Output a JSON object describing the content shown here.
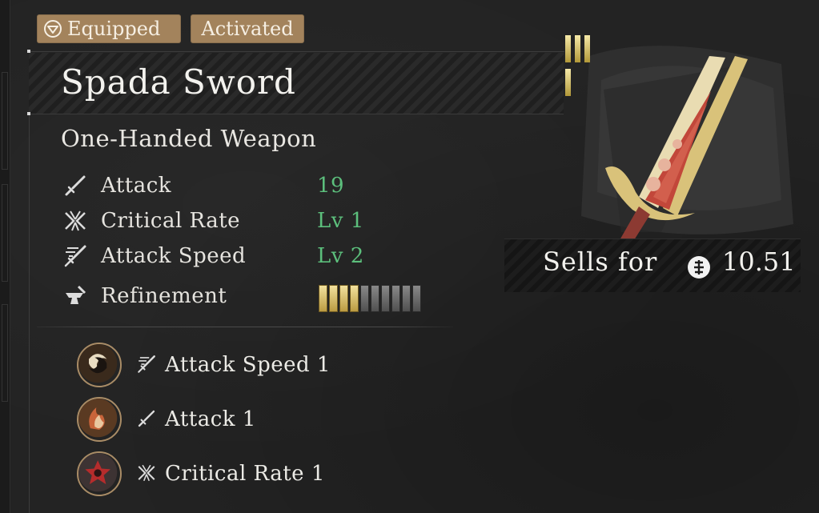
{
  "badges": {
    "equipped": "Equipped",
    "activated": "Activated"
  },
  "item": {
    "name": "Spada Sword",
    "type": "One-Handed Weapon",
    "rarity_pips": 4,
    "accent_color": "#c9ad57"
  },
  "stats": [
    {
      "icon": "sword-icon",
      "label": "Attack",
      "value": "19"
    },
    {
      "icon": "critical-rate-icon",
      "label": "Critical Rate",
      "value": "Lv 1"
    },
    {
      "icon": "attack-speed-icon",
      "label": "Attack Speed",
      "value": "Lv 2"
    },
    {
      "icon": "anvil-icon",
      "label": "Refinement",
      "refinement": {
        "filled": 4,
        "total": 10
      }
    }
  ],
  "effects": [
    {
      "orb": "swirl-orb-icon",
      "icon": "attack-speed-icon",
      "label": "Attack Speed 1"
    },
    {
      "orb": "flame-orb-icon",
      "icon": "sword-icon",
      "label": "Attack 1"
    },
    {
      "orb": "crimson-orb-icon",
      "icon": "critical-rate-icon",
      "label": "Critical Rate 1"
    }
  ],
  "sell": {
    "label": "Sells for",
    "icon": "coin-icon",
    "value": "10.51"
  },
  "colors": {
    "stat_value": "#5cbf7c",
    "badge": "#a3835c",
    "text": "#ecebe6"
  }
}
